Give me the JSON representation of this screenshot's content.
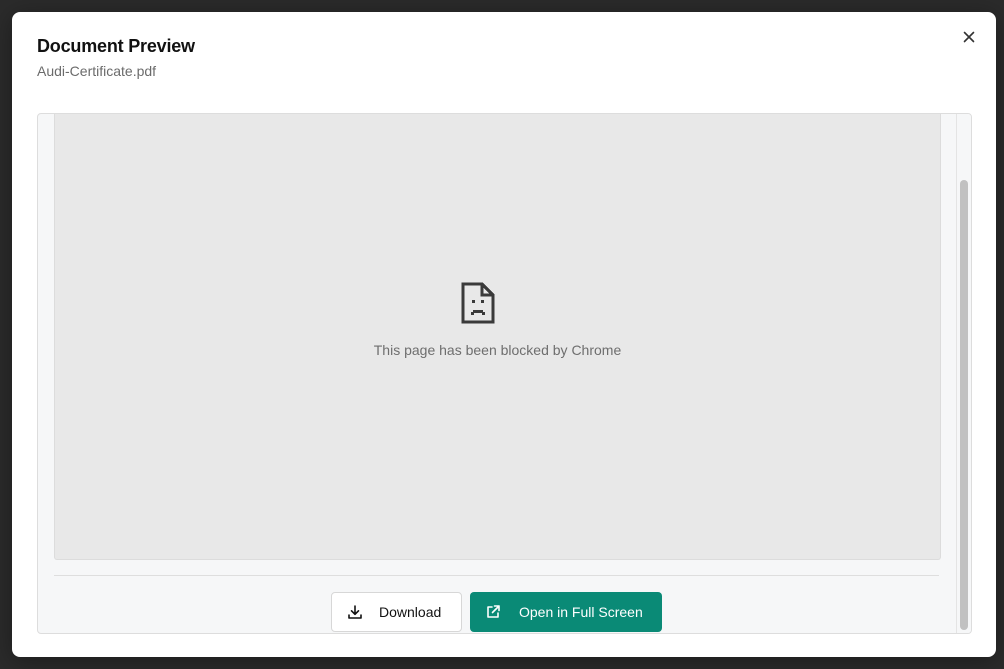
{
  "dialog": {
    "title": "Document Preview",
    "filename": "Audi-Certificate.pdf",
    "close_icon": "close-icon"
  },
  "viewer": {
    "blocked_message": "This page has been blocked by Chrome",
    "blocked_icon": "sad-document-icon"
  },
  "actions": {
    "download_label": "Download",
    "download_icon": "download-icon",
    "fullscreen_label": "Open in Full Screen",
    "fullscreen_icon": "external-link-icon",
    "primary_color": "#0a8a76"
  }
}
